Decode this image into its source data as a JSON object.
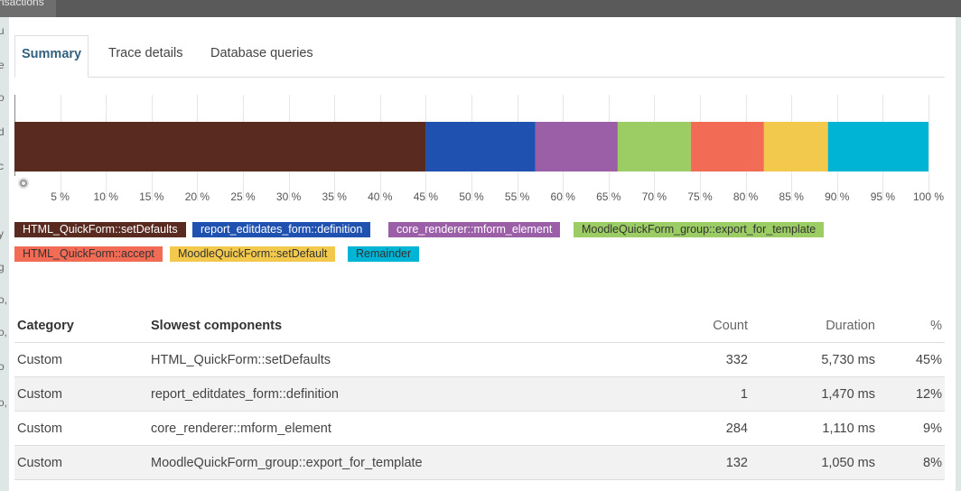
{
  "window": {
    "tab_label": "nsactions"
  },
  "tabs": [
    {
      "label": "Summary",
      "active": true
    },
    {
      "label": "Trace details",
      "active": false
    },
    {
      "label": "Database queries",
      "active": false
    }
  ],
  "chart_data": {
    "type": "bar",
    "orientation": "horizontal-stacked",
    "x_ticks": [
      "5 %",
      "10 %",
      "15 %",
      "20 %",
      "25 %",
      "30 %",
      "35 %",
      "40 %",
      "45 %",
      "50 %",
      "55 %",
      "60 %",
      "65 %",
      "70 %",
      "75 %",
      "80 %",
      "85 %",
      "90 %",
      "95 %",
      "100 %"
    ],
    "xlim": [
      0,
      100
    ],
    "grid": true,
    "series": [
      {
        "name": "HTML_QuickForm::setDefaults",
        "value": 45,
        "color": "#582a20"
      },
      {
        "name": "report_editdates_form::definition",
        "value": 12,
        "color": "#1f51b0"
      },
      {
        "name": "core_renderer::mform_element",
        "value": 9,
        "color": "#9b5fa8"
      },
      {
        "name": "MoodleQuickForm_group::export_for_template",
        "value": 8,
        "color": "#9ccc64"
      },
      {
        "name": "HTML_QuickForm::accept",
        "value": 8,
        "color": "#f16b55"
      },
      {
        "name": "MoodleQuickForm::setDefault",
        "value": 7,
        "color": "#f2c94c"
      },
      {
        "name": "Remainder",
        "value": 11,
        "color": "#00b4d6"
      }
    ]
  },
  "legend": [
    {
      "label": "HTML_QuickForm::setDefaults",
      "bg": "#582a20",
      "fg": "#ffffff"
    },
    {
      "label": "report_editdates_form::definition",
      "bg": "#1f51b0",
      "fg": "#ffffff"
    },
    {
      "label": "core_renderer::mform_element",
      "bg": "#9b5fa8",
      "fg": "#ffffff"
    },
    {
      "label": "MoodleQuickForm_group::export_for_template",
      "bg": "#9ccc64",
      "fg": "#333333"
    },
    {
      "label": "HTML_QuickForm::accept",
      "bg": "#f16b55",
      "fg": "#333333"
    },
    {
      "label": "MoodleQuickForm::setDefault",
      "bg": "#f2c94c",
      "fg": "#333333"
    },
    {
      "label": "Remainder",
      "bg": "#00b4d6",
      "fg": "#333333"
    }
  ],
  "table": {
    "headers": {
      "category": "Category",
      "components": "Slowest components",
      "count": "Count",
      "duration": "Duration",
      "pct": "%"
    },
    "rows": [
      {
        "category": "Custom",
        "component": "HTML_QuickForm::setDefaults",
        "count": "332",
        "duration": "5,730 ms",
        "pct": "45%"
      },
      {
        "category": "Custom",
        "component": "report_editdates_form::definition",
        "count": "1",
        "duration": "1,470 ms",
        "pct": "12%"
      },
      {
        "category": "Custom",
        "component": "core_renderer::mform_element",
        "count": "284",
        "duration": "1,110 ms",
        "pct": "9%"
      },
      {
        "category": "Custom",
        "component": "MoodleQuickForm_group::export_for_template",
        "count": "132",
        "duration": "1,050 ms",
        "pct": "8%"
      }
    ]
  },
  "background_fragments": [
    "u",
    "e",
    "o",
    "d",
    "c",
    "y",
    "g",
    "o,",
    "o,",
    "o",
    "o,"
  ]
}
